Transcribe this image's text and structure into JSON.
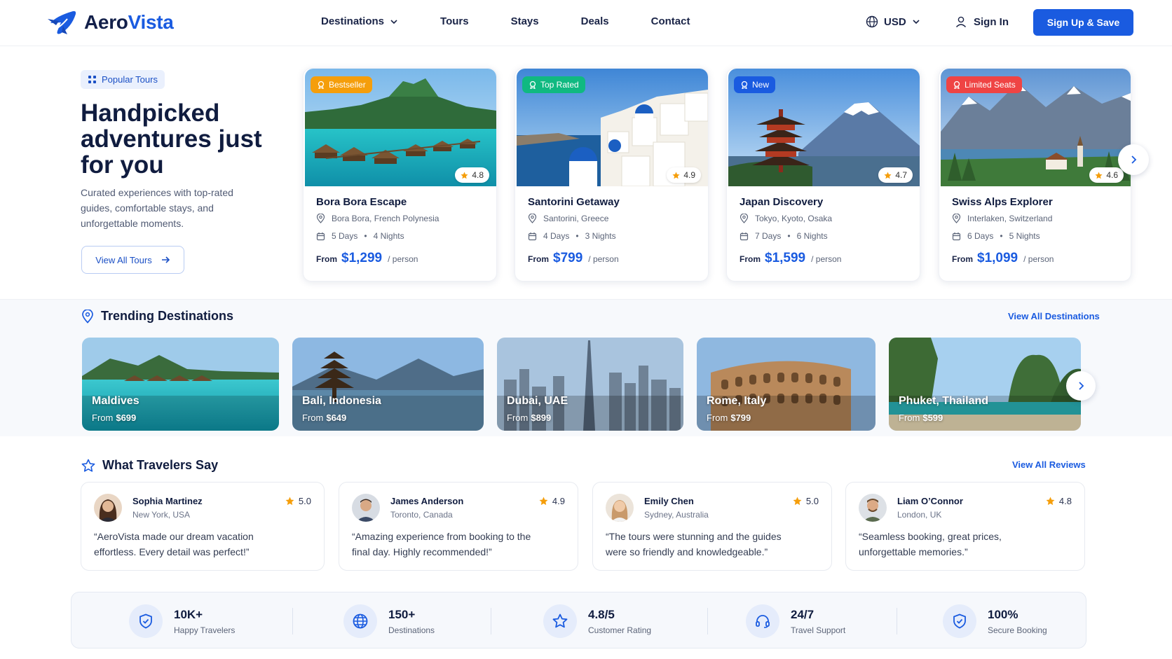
{
  "brand": {
    "name_part1": "Aero",
    "name_part2": "Vista",
    "color": "#1a5be0"
  },
  "nav": {
    "items": [
      {
        "label": "Destinations",
        "has_dropdown": true
      },
      {
        "label": "Tours"
      },
      {
        "label": "Stays"
      },
      {
        "label": "Deals"
      },
      {
        "label": "Contact"
      }
    ],
    "currency": "USD",
    "sign_in": "Sign In",
    "sign_up": "Sign Up & Save"
  },
  "hero": {
    "tag": "Popular Tours",
    "title": "Handpicked adventures just for you",
    "subtitle": "Curated experiences with top-rated guides, comfortable stays, and unforgettable moments.",
    "cta": "View All Tours"
  },
  "tours": [
    {
      "badge": "Bestseller",
      "badge_color": "#f59e0b",
      "rating": "4.8",
      "name": "Bora Bora Escape",
      "location": "Bora Bora, French Polynesia",
      "days": "5 Days",
      "nights": "4 Nights",
      "from": "From",
      "price": "$1,299",
      "per": "/ person",
      "icon": "bungalow-photo"
    },
    {
      "badge": "Top Rated",
      "badge_color": "#10b981",
      "rating": "4.9",
      "name": "Santorini Getaway",
      "location": "Santorini, Greece",
      "days": "4 Days",
      "nights": "3 Nights",
      "from": "From",
      "price": "$799",
      "per": "/ person",
      "icon": "santorini-photo"
    },
    {
      "badge": "New",
      "badge_color": "#1a5be0",
      "rating": "4.7",
      "name": "Japan Discovery",
      "location": "Tokyo, Kyoto, Osaka",
      "days": "7 Days",
      "nights": "6 Nights",
      "from": "From",
      "price": "$1,599",
      "per": "/ person",
      "icon": "pagoda-photo"
    },
    {
      "badge": "Limited Seats",
      "badge_color": "#ef4444",
      "rating": "4.6",
      "name": "Swiss Alps Explorer",
      "location": "Interlaken, Switzerland",
      "days": "6 Days",
      "nights": "5 Nights",
      "from": "From",
      "price": "$1,099",
      "per": "/ person",
      "icon": "alps-photo"
    }
  ],
  "trending": {
    "title": "Trending Destinations",
    "link": "View All Destinations",
    "items": [
      {
        "name": "Maldives",
        "from": "From",
        "price": "$699"
      },
      {
        "name": "Bali, Indonesia",
        "from": "From",
        "price": "$649"
      },
      {
        "name": "Dubai, UAE",
        "from": "From",
        "price": "$899"
      },
      {
        "name": "Rome, Italy",
        "from": "From",
        "price": "$799"
      },
      {
        "name": "Phuket, Thailand",
        "from": "From",
        "price": "$599"
      }
    ]
  },
  "reviews": {
    "title": "What Travelers Say",
    "link": "View All Reviews",
    "items": [
      {
        "name": "Sophia Martinez",
        "location": "New York, USA",
        "rating": "5.0",
        "text": "“AeroVista made our dream vacation effortless. Every detail was perfect!”"
      },
      {
        "name": "James Anderson",
        "location": "Toronto, Canada",
        "rating": "4.9",
        "text": "“Amazing experience from booking to the final day. Highly recommended!”"
      },
      {
        "name": "Emily Chen",
        "location": "Sydney, Australia",
        "rating": "5.0",
        "text": "“The tours were stunning and the guides were so friendly and knowledgeable.”"
      },
      {
        "name": "Liam O’Connor",
        "location": "London, UK",
        "rating": "4.8",
        "text": "“Seamless booking, great prices, unforgettable memories.”"
      }
    ]
  },
  "stats": [
    {
      "value": "10K+",
      "label": "Happy Travelers",
      "icon": "shield-check-icon"
    },
    {
      "value": "150+",
      "label": "Destinations",
      "icon": "globe-icon"
    },
    {
      "value": "4.8/5",
      "label": "Customer Rating",
      "icon": "star-icon"
    },
    {
      "value": "24/7",
      "label": "Travel Support",
      "icon": "headset-icon"
    },
    {
      "value": "100%",
      "label": "Secure Booking",
      "icon": "shield-check-icon"
    }
  ]
}
